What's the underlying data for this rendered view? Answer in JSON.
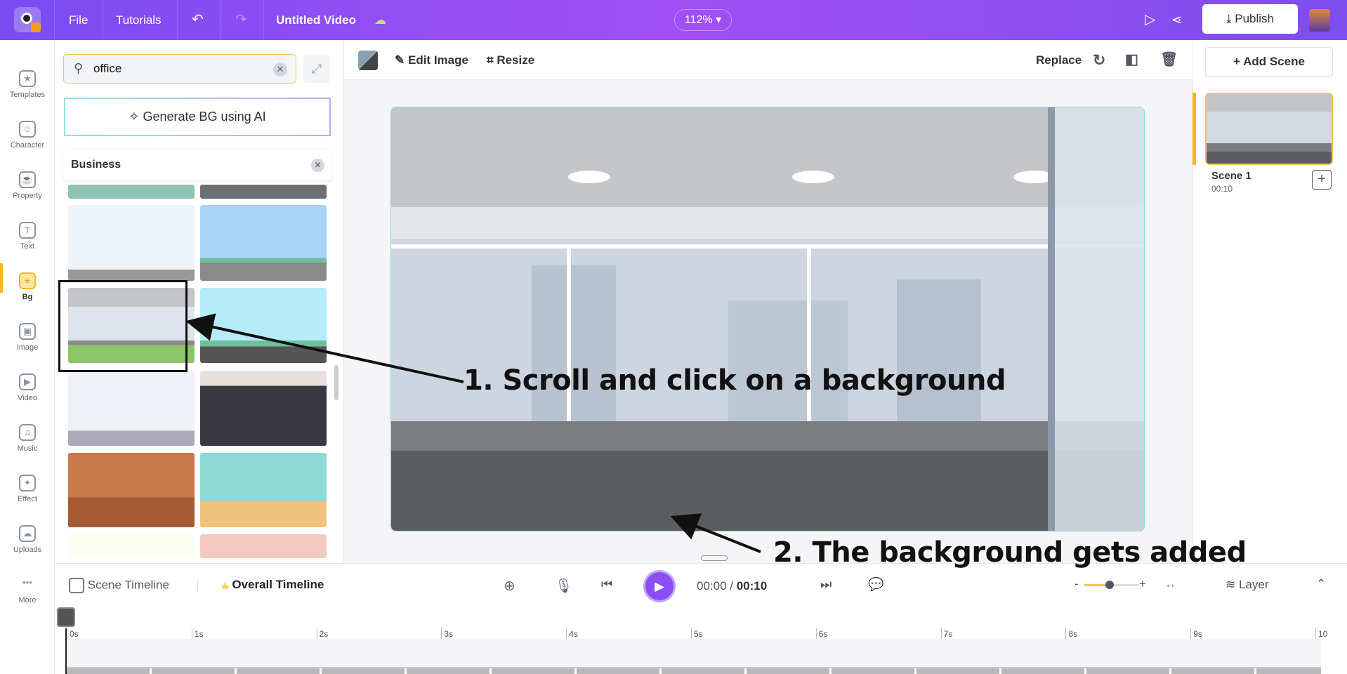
{
  "topbar": {
    "menu": [
      "File",
      "Tutorials"
    ],
    "title": "Untitled Video",
    "zoom": "112%",
    "publish": "Publish"
  },
  "rail": [
    {
      "label": "Templates",
      "icon": "templates-icon",
      "g": "★"
    },
    {
      "label": "Character",
      "icon": "character-icon",
      "g": "☺"
    },
    {
      "label": "Property",
      "icon": "property-icon",
      "g": "☕"
    },
    {
      "label": "Text",
      "icon": "text-icon",
      "g": "T"
    },
    {
      "label": "Bg",
      "icon": "bg-icon",
      "g": "≡"
    },
    {
      "label": "Image",
      "icon": "image-icon",
      "g": "▣"
    },
    {
      "label": "Video",
      "icon": "video-icon",
      "g": "▶"
    },
    {
      "label": "Music",
      "icon": "music-icon",
      "g": "♫"
    },
    {
      "label": "Effect",
      "icon": "effect-icon",
      "g": "✦"
    },
    {
      "label": "Uploads",
      "icon": "uploads-icon",
      "g": "☁"
    },
    {
      "label": "More",
      "icon": "more-icon",
      "g": "•••"
    }
  ],
  "panel": {
    "search_value": "office",
    "generate": "Generate BG using AI",
    "category": "Business"
  },
  "toolbar": {
    "edit_image": "Edit Image",
    "resize": "Resize",
    "replace": "Replace"
  },
  "right": {
    "add_scene": "+ Add Scene",
    "scene_name": "Scene 1",
    "scene_duration": "00:10"
  },
  "timeline": {
    "scene_timeline": "Scene Timeline",
    "overall_timeline": "Overall Timeline",
    "current": "00:00",
    "separator": " / ",
    "total": "00:10",
    "layer": "Layer",
    "ticks": [
      "0s",
      "1s",
      "2s",
      "3s",
      "4s",
      "5s",
      "6s",
      "7s",
      "8s",
      "9s",
      "10"
    ]
  },
  "annotations": {
    "step1": "1. Scroll and click on a background",
    "step2": "2. The background gets added"
  },
  "colors": {
    "accent": "#8b4ef4",
    "active": "#f5b622",
    "selection": "#7fe0cf"
  }
}
